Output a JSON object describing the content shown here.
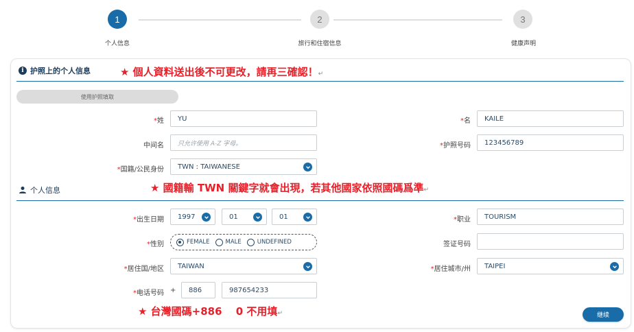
{
  "stepper": {
    "steps": [
      {
        "number": "1",
        "label": "个人信息"
      },
      {
        "number": "2",
        "label": "旅行和住宿信息"
      },
      {
        "number": "3",
        "label": "健康声明"
      }
    ]
  },
  "passport_section": {
    "title": "护照上的个人信息",
    "note": "★ 個人資料送出後不可更改，請再三確認！",
    "use_passport_button": "使用护照填取",
    "fields": {
      "surname": {
        "label": "姓",
        "value": "YU"
      },
      "given_name": {
        "label": "名",
        "value": "KAILE"
      },
      "middle_name": {
        "label": "中间名",
        "value": "",
        "placeholder": "只允许使用 A-Z 字母。"
      },
      "passport_number": {
        "label": "护照号码",
        "value": "123456789"
      },
      "nationality": {
        "label": "国籍/公民身份",
        "value": "TWN : TAIWANESE"
      }
    }
  },
  "personal_section": {
    "title": "个人信息",
    "note": "★ 國籍輸 TWN 關鍵字就會出現，若其他國家依照國碼爲準",
    "fields": {
      "dob": {
        "label": "出生日期",
        "year": "1997",
        "month": "01",
        "day": "01"
      },
      "occupation": {
        "label": "职业",
        "value": "TOURISM"
      },
      "gender": {
        "label": "性别",
        "options": [
          "FEMALE",
          "MALE",
          "UNDEFINED"
        ],
        "selected": "FEMALE"
      },
      "visa_number": {
        "label": "签证号码",
        "value": ""
      },
      "country_of_residence": {
        "label": "居住国/地区",
        "value": "TAIWAN"
      },
      "city_of_residence": {
        "label": "居住城市/州",
        "value": "TAIPEI"
      },
      "phone": {
        "label": "电话号码",
        "plus": "+",
        "country_code": "886",
        "number": "987654233"
      }
    },
    "phone_note": "★ 台灣國碼+886　 0 不用填"
  },
  "actions": {
    "continue": "继续"
  },
  "colors": {
    "accent": "#1a6ca8",
    "note_red": "#e8202a",
    "heading": "#1d3c5c"
  }
}
